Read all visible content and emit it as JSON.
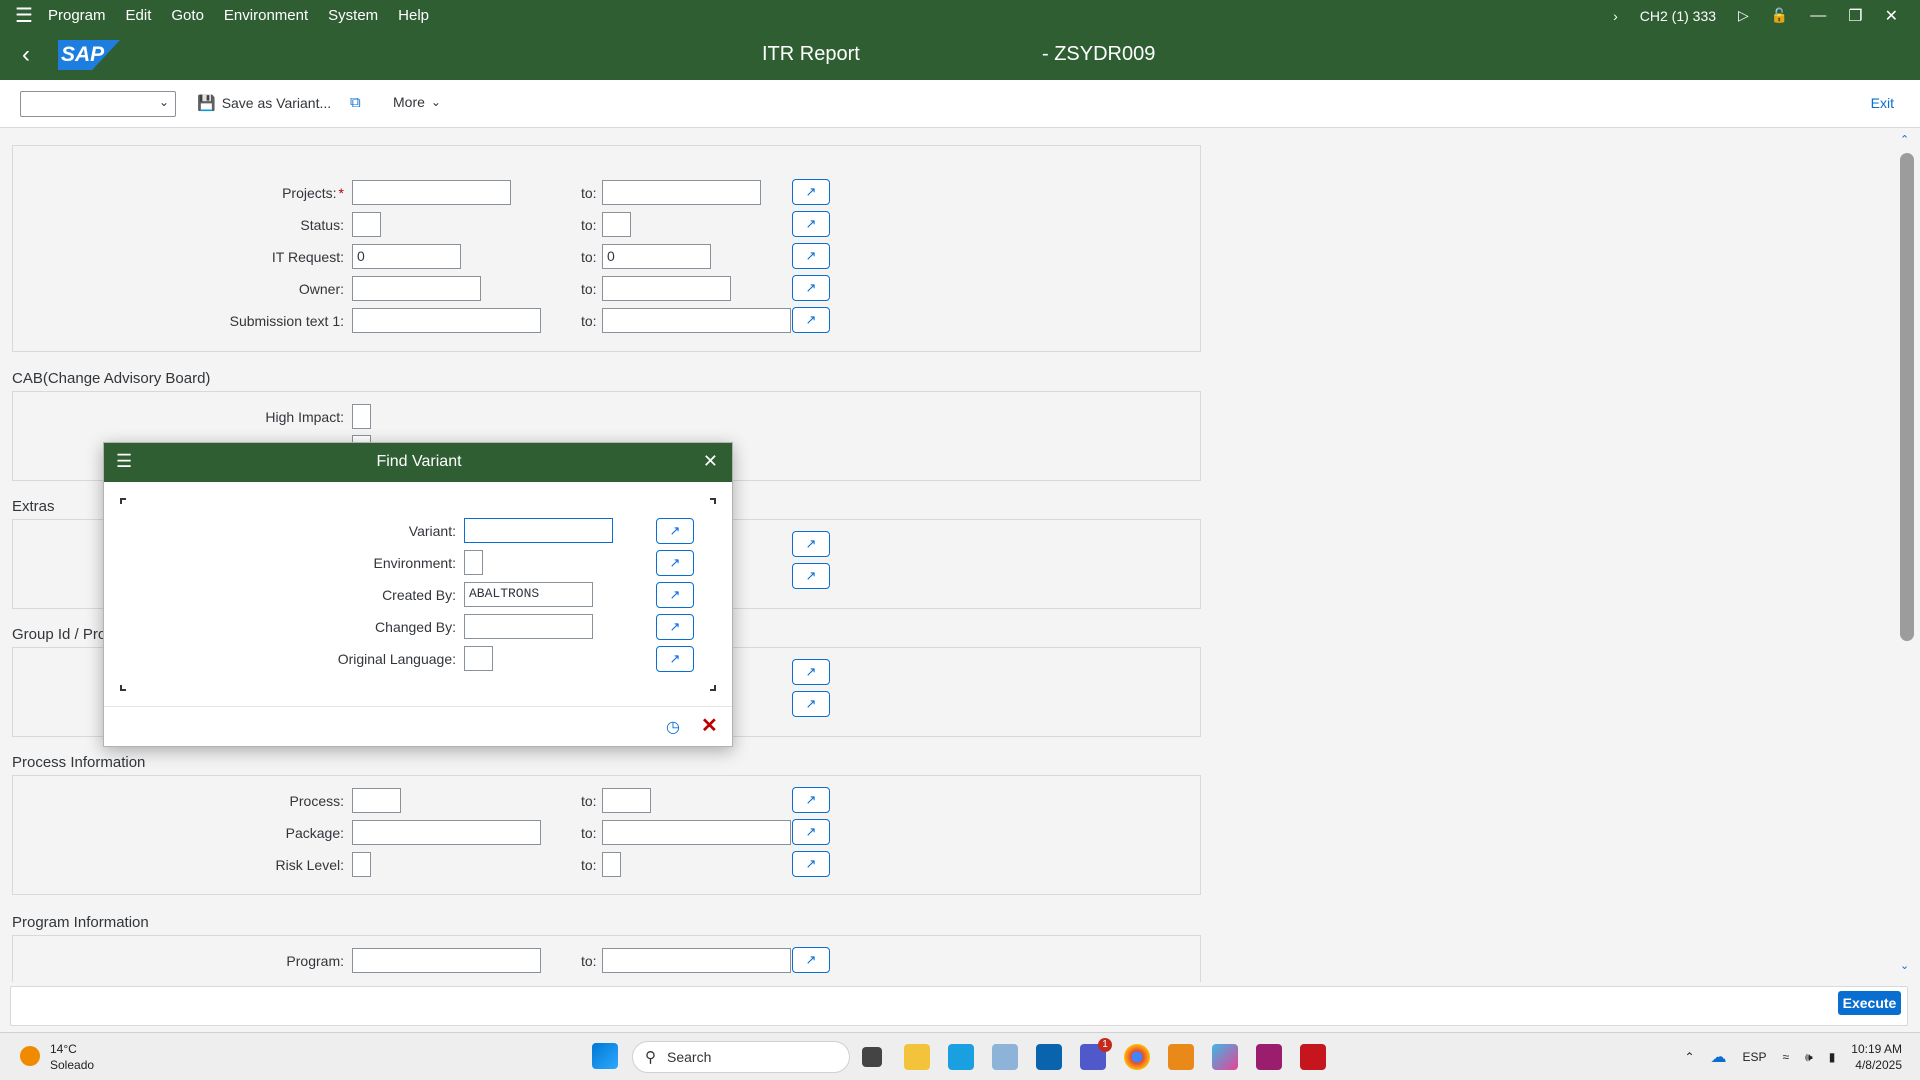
{
  "menubar": {
    "items": [
      "Program",
      "Edit",
      "Goto",
      "Environment",
      "System",
      "Help"
    ],
    "system_info": "CH2 (1) 333"
  },
  "titlebar": {
    "title": "ITR Report",
    "program": "- ZSYDR009",
    "logo_text": "SAP"
  },
  "toolbar": {
    "variant_value": "",
    "save_as_variant": "Save as Variant...",
    "more": "More",
    "exit": "Exit"
  },
  "selection": {
    "rows": [
      {
        "label": "Projects:",
        "required": "*",
        "from": "",
        "to_label": "to:",
        "to": ""
      },
      {
        "label": "Status:",
        "from": "",
        "to_label": "to:",
        "to": ""
      },
      {
        "label": "IT Request:",
        "from": "0",
        "to_label": "to:",
        "to": "0"
      },
      {
        "label": "Owner:",
        "from": "",
        "to_label": "to:",
        "to": ""
      },
      {
        "label": "Submission text 1:",
        "from": "",
        "to_label": "to:",
        "to": ""
      }
    ]
  },
  "cab": {
    "title": "CAB(Change Advisory Board)",
    "high_impact_label": "High Impact:"
  },
  "extras": {
    "title": "Extras"
  },
  "group_id": {
    "title": "Group Id / Pro"
  },
  "process": {
    "title": "Process Information",
    "rows": [
      {
        "label": "Process:",
        "to_label": "to:"
      },
      {
        "label": "Package:",
        "to_label": "to:"
      },
      {
        "label": "Risk Level:",
        "to_label": "to:"
      }
    ]
  },
  "program_info": {
    "title": "Program Information",
    "rows": [
      {
        "label": "Program:",
        "to_label": "to:"
      }
    ]
  },
  "footer": {
    "command_value": "",
    "execute": "Execute"
  },
  "dialog": {
    "title": "Find Variant",
    "fields": [
      {
        "label": "Variant:",
        "value": ""
      },
      {
        "label": "Environment:",
        "value": ""
      },
      {
        "label": "Created By:",
        "value": "ABALTRONS"
      },
      {
        "label": "Changed By:",
        "value": ""
      },
      {
        "label": "Original Language:",
        "value": ""
      }
    ]
  },
  "taskbar": {
    "temperature": "14°C",
    "weather": "Soleado",
    "search_placeholder": "Search",
    "language": "ESP",
    "time": "10:19 AM",
    "date": "4/8/2025",
    "teams_badge": "1"
  },
  "colors": {
    "shell": "#2f5e33",
    "accent": "#0a6ed1",
    "cancel": "#bb0000"
  }
}
